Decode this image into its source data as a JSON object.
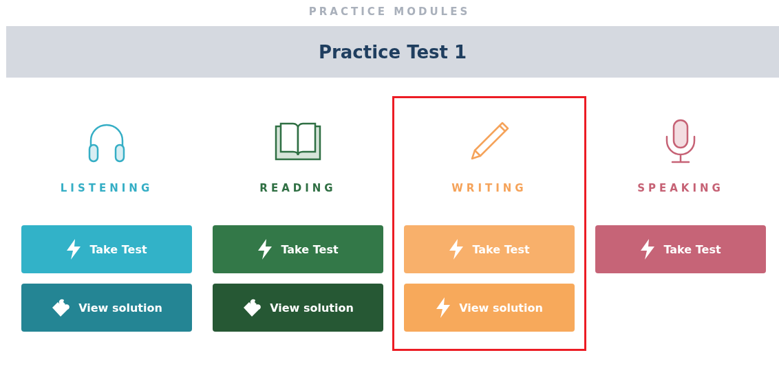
{
  "section_title": "PRACTICE MODULES",
  "test_title": "Practice Test 1",
  "modules": [
    {
      "kind": "headphones",
      "label": "LISTENING",
      "color": "#35aec5",
      "highlighted": false,
      "buttons": [
        {
          "label": "Take Test",
          "kind": "bolt",
          "color": "#32b2c8"
        },
        {
          "label": "View solution",
          "kind": "puzzle",
          "color": "#248594"
        }
      ]
    },
    {
      "kind": "book",
      "label": "READING",
      "color": "#2f6f43",
      "highlighted": false,
      "buttons": [
        {
          "label": "Take Test",
          "kind": "bolt",
          "color": "#337848"
        },
        {
          "label": "View solution",
          "kind": "puzzle",
          "color": "#265834"
        }
      ]
    },
    {
      "kind": "pencil",
      "label": "WRITING",
      "color": "#f5a35a",
      "highlighted": true,
      "buttons": [
        {
          "label": "Take Test",
          "kind": "bolt",
          "color": "#f8b06b"
        },
        {
          "label": "View solution",
          "kind": "bolt",
          "color": "#f7a95b"
        }
      ]
    },
    {
      "kind": "microphone",
      "label": "SPEAKING",
      "color": "#c66275",
      "highlighted": false,
      "buttons": [
        {
          "label": "Take Test",
          "kind": "bolt",
          "color": "#c66477"
        }
      ]
    }
  ]
}
